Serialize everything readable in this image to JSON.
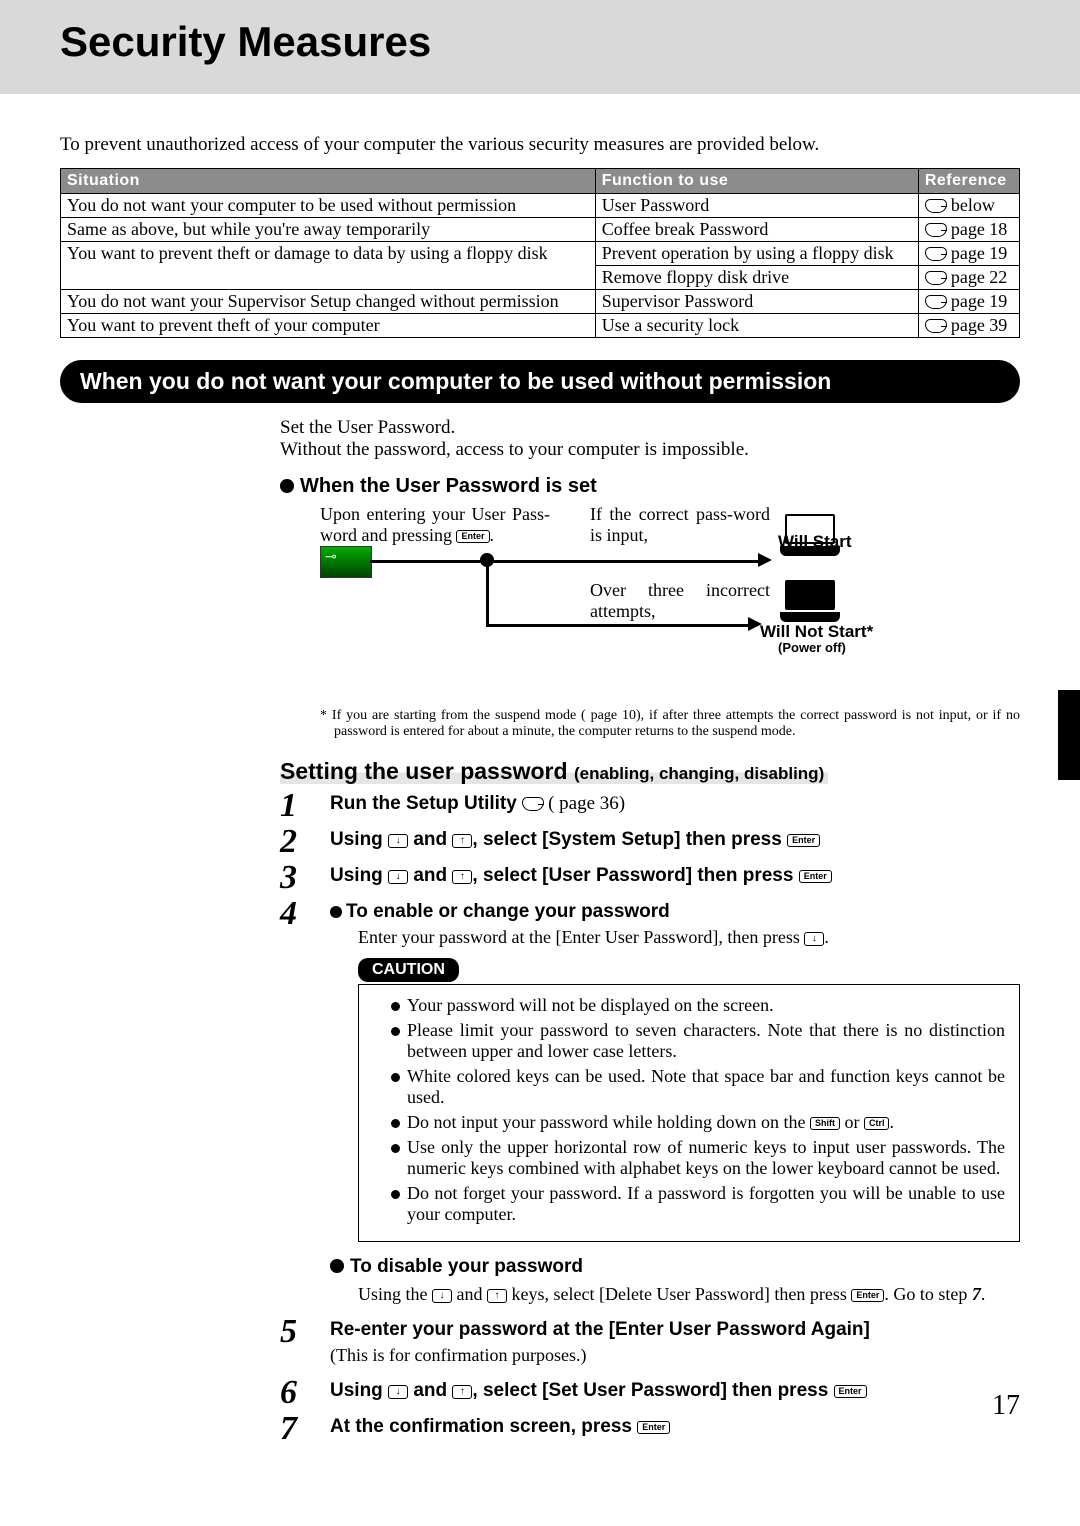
{
  "page_title": "Security Measures",
  "page_number": "17",
  "intro": "To prevent unauthorized access of your computer the various security measures are provided below.",
  "table": {
    "headers": {
      "situation": "Situation",
      "function": "Function to use",
      "reference": "Reference"
    },
    "rows": [
      {
        "situation": "You do not want your computer to be used without permission",
        "function": "User Password",
        "ref": "below"
      },
      {
        "situation": "Same as above, but while you're away temporarily",
        "function": "Coffee break Password",
        "ref": "page 18"
      },
      {
        "situation": "You want to prevent theft or damage to data by using a floppy disk",
        "function": "Prevent operation by using a floppy disk",
        "ref": "page 19"
      },
      {
        "situation": "",
        "function": "Remove floppy disk drive",
        "ref": "page 22"
      },
      {
        "situation": "You do not want your Supervisor Setup changed without permission",
        "function": "Supervisor Password",
        "ref": "page 19"
      },
      {
        "situation": "You want to prevent theft of your computer",
        "function": "Use a security lock",
        "ref": "page 39"
      }
    ]
  },
  "main_heading": "When you do not want your computer to be used without permission",
  "set_text_1": "Set the User Password.",
  "set_text_2": "Without the password, access to your computer is impossible.",
  "when_set_heading": "When the User Password is set",
  "diagram": {
    "entry_text": "Upon entering your User Pass-word and pressing ",
    "enter_key": "Enter",
    "correct_text": "If the correct pass-word is input,",
    "will_start": "Will Start",
    "incorrect_text": "Over three incorrect attempts,",
    "will_not_start": "Will Not Start*",
    "power_off": "(Power off)"
  },
  "footnote_text": "If you are starting from the suspend mode ( page 10), if after three attempts the correct password is not input, or if no password is entered for about a minute, the computer returns to the suspend mode.",
  "footnote_prefix": "*",
  "section2_title": "Setting the user password",
  "section2_subtitle": "(enabling, changing, disabling)",
  "steps": {
    "s1_a": "Run the Setup Utility",
    "s1_b": "( page 36)",
    "s2": "Using  and , select [System Setup] then press ",
    "s3": "Using  and , select [User Password] then press ",
    "s4_bullet": "To enable or change your password",
    "s4_body": "Enter your password at the [Enter User Password], then press .",
    "caution_label": "CAUTION",
    "caution_items": [
      "Your password will not be displayed on the screen.",
      "Please limit your password to seven characters.  Note that there is no distinction between upper and lower case letters.",
      "White colored keys can be used. Note that space bar and function keys cannot be used.",
      "Do not input your password while holding down on the  or .",
      "Use only the upper horizontal row of numeric keys to input user passwords. The numeric keys combined with alphabet keys on the lower keyboard cannot be used.",
      "Do not forget your password.  If a password is forgotten you will be unable to use your computer."
    ],
    "shift_key": "Shift",
    "ctrl_key": "Ctrl",
    "disable_heading": "To disable your password",
    "disable_body_a": "Using the  and  keys, select [Delete User Password] then press .  Go to step ",
    "disable_body_step": "7",
    "s5": "Re-enter your password at the [Enter User Password Again]",
    "s5_body": "(This is for confirmation purposes.)",
    "s6": "Using  and , select [Set User Password] then press ",
    "s7": "At the confirmation screen, press "
  }
}
